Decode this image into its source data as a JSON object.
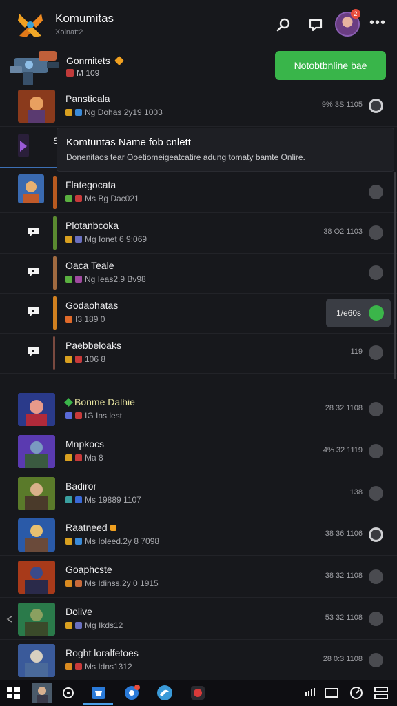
{
  "app": {
    "title": "Komumitas",
    "subtitle": "Xoinat:2"
  },
  "header_icons": [
    "search-icon",
    "chat-icon",
    "avatar",
    "more-icon"
  ],
  "notification_count": "2",
  "community": {
    "name": "Gonmitets",
    "meta": "M 109",
    "action_button": "Notobtbnline bae"
  },
  "popup": {
    "title": "Komtuntas Name fob cnlett",
    "text": "Donenitaos tear Ooetiomeigeatcatire adung tomaty bamte Onlire."
  },
  "hidden_row_letter": "S",
  "top_rows": [
    {
      "name": "Pansticala",
      "meta": "Ng Dohas 2y19 1003",
      "stat": "9% 3S 1105"
    }
  ],
  "sub_rows": [
    {
      "name": "Flategocata",
      "meta": "Ms Bg Dac021",
      "stat": ""
    },
    {
      "name": "Plotanbcoka",
      "meta": "Mg Ionet 6 9:069",
      "stat": "38 O2 1103"
    },
    {
      "name": "Oaca Teale",
      "meta": "Ng Ieas2.9 Bv98",
      "stat": ""
    },
    {
      "name": "Godaohatas",
      "meta": "I3 189 0",
      "stat": ""
    },
    {
      "name": "Paebbeloaks",
      "meta": "106 8",
      "stat": "119"
    }
  ],
  "online_pill": {
    "text": "1/e60s"
  },
  "rows": [
    {
      "name": "Bonme Dalhie",
      "meta": "IG Ins lest",
      "stat": "28 32 1108"
    },
    {
      "name": "Mnpkocs",
      "meta": "Ma 8",
      "stat": "4% 32 1119"
    },
    {
      "name": "Badiror",
      "meta": "Ms 19889 1107",
      "stat": "138"
    },
    {
      "name": "Raatneed",
      "meta": "Ms Ioleed.2y 8 7098",
      "stat": "38 36 1106"
    },
    {
      "name": "Goaphcste",
      "meta": "Ms Idinss.2y 0 1915",
      "stat": "38 32 1108"
    },
    {
      "name": "Dolive",
      "meta": "Mg Ikds12",
      "stat": "53 32 1108"
    },
    {
      "name": "Roght loralfetoes",
      "meta": "Ms Idns1312",
      "stat": "28 0:3 1108"
    }
  ],
  "colors": {
    "accent_green": "#39b54a",
    "online_green": "#3bb54a",
    "background": "#17181c",
    "tab_underline": "#3c6fb5"
  },
  "taskbar_icons": [
    "windows-start-icon",
    "app-thumb",
    "circle-icon",
    "store-icon",
    "browser-icon",
    "edge-icon",
    "record-icon",
    "network-icon",
    "window-icon",
    "clock-icon",
    "settings-icon"
  ]
}
